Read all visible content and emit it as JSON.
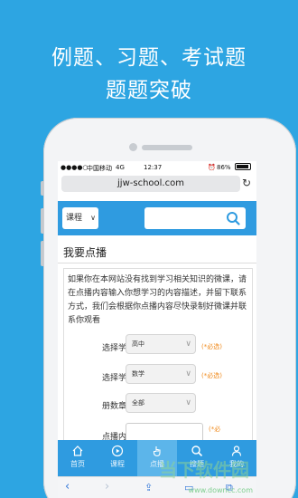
{
  "promo": {
    "line1": "例题、习题、考试题",
    "line2": "题题突破"
  },
  "status_bar": {
    "signal": "●●●●○",
    "carrier": "中国移动",
    "network": "4G",
    "time": "12:37",
    "battery": "86%"
  },
  "browser": {
    "url": "jjw-school.com",
    "reload_icon": "reload-icon"
  },
  "header": {
    "course_select_label": "课程",
    "search_placeholder": ""
  },
  "page": {
    "title": "我要点播",
    "description": "如果你在本网站没有找到学习相关知识的微课，请在点播内容输入你想学习的内容描述，并留下联系方式，我们会根据你点播内容尽快录制好微课并联系你观看"
  },
  "form": {
    "stage": {
      "label": "选择学段:",
      "value": "高中",
      "required": "(*必选)"
    },
    "subject": {
      "label": "选择学科:",
      "value": "数学",
      "required": "(*必选)"
    },
    "chapter": {
      "label": "册数章节:",
      "value": "全部"
    },
    "content": {
      "label": "点播内容:",
      "required": "(*必"
    }
  },
  "tabbar": {
    "items": [
      {
        "label": "首页",
        "icon": "home-icon"
      },
      {
        "label": "课程",
        "icon": "play-icon"
      },
      {
        "label": "点播",
        "icon": "hand-icon"
      },
      {
        "label": "搜题",
        "icon": "search-icon"
      },
      {
        "label": "我的",
        "icon": "user-icon"
      }
    ],
    "active_index": 2
  },
  "watermark": {
    "cn": "当下软件园",
    "url": "www.downcc.com"
  },
  "colors": {
    "background": "#2da5e2",
    "accent": "#2f9be0",
    "required": "#f08a1c"
  }
}
